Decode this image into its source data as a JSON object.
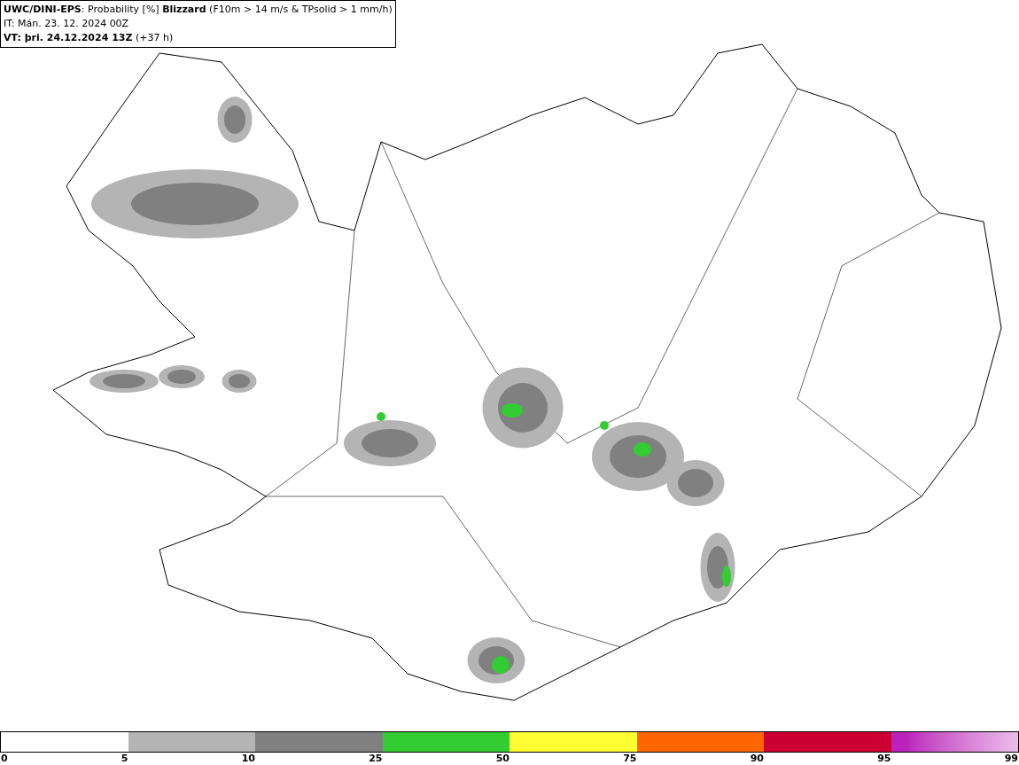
{
  "header": {
    "lines": [
      "**UWC/DINI-EPS**: Probability [%] **Blizzard** (F10m > 14 m/s & TPsolid > 1 mm/h)",
      "IT: Mán. 23. 12. 2024 00Z",
      "**VT: þri. 24.12.2024 13Z** (+37 h)"
    ]
  },
  "legend": {
    "segments": [
      {
        "color": "#b4b4b4"
      },
      {
        "color": "#808080"
      },
      {
        "color": "#33cc33"
      },
      {
        "color": "#ffff33"
      },
      {
        "color": "#ff6600"
      },
      {
        "color": "#cc0033"
      },
      {
        "color": "#bb22bb",
        "kind": "gradient"
      }
    ],
    "labels": [
      "0",
      "5",
      "10",
      "25",
      "50",
      "75",
      "90",
      "95",
      "99"
    ]
  }
}
